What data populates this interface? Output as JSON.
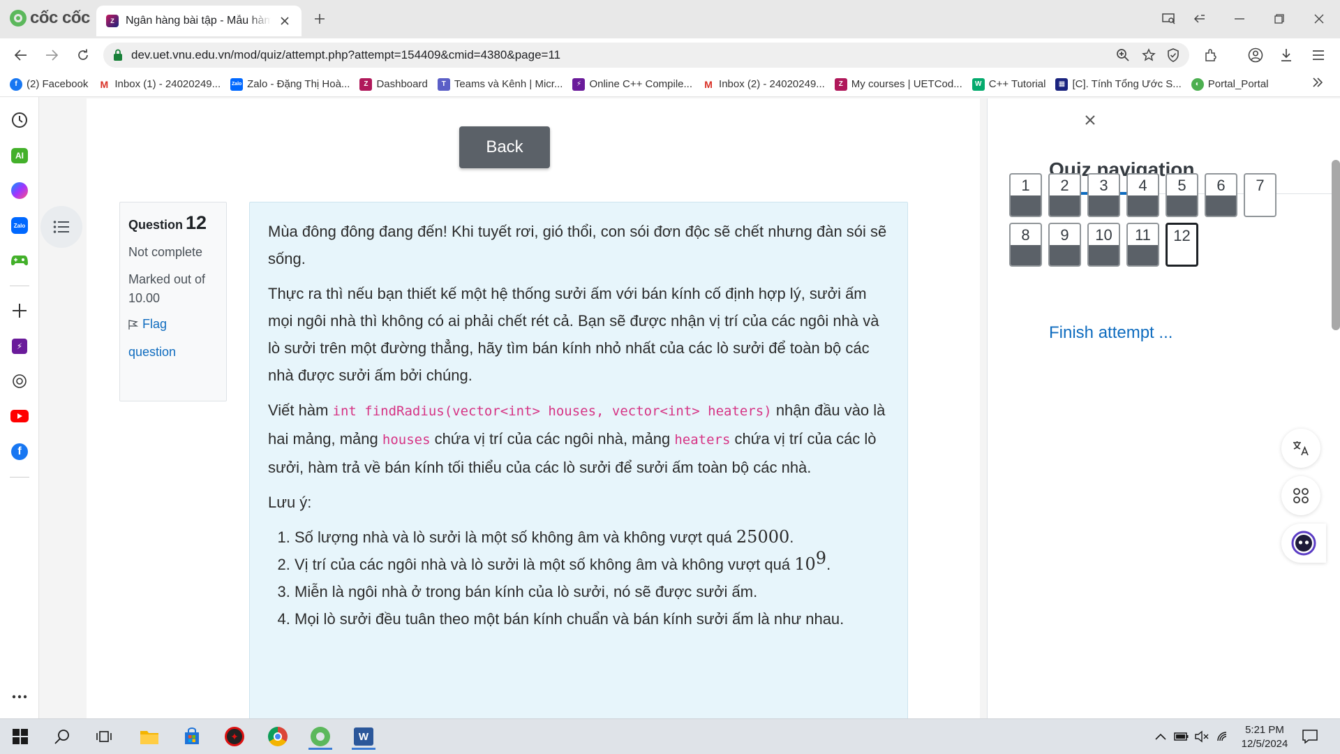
{
  "browser": {
    "brand": "cốc cốc",
    "tab_title": "Ngân hàng bài tập - Mẫu hàm",
    "url": "dev.uet.vnu.edu.vn/mod/quiz/attempt.php?attempt=154409&cmid=4380&page=11"
  },
  "bookmarks": [
    {
      "label": "(2) Facebook",
      "icon": "facebook-icon",
      "color": "#1877f2"
    },
    {
      "label": "Inbox (1) - 24020249...",
      "icon": "gmail-icon",
      "color": "#d93025"
    },
    {
      "label": "Zalo - Đặng Thị Hoà...",
      "icon": "zalo-icon",
      "color": "#0068ff"
    },
    {
      "label": "Dashboard",
      "icon": "moodle-icon",
      "color": "#b0185a"
    },
    {
      "label": "Teams và Kênh | Micr...",
      "icon": "teams-icon",
      "color": "#5b5fc7"
    },
    {
      "label": "Online C++ Compile...",
      "icon": "compiler-icon",
      "color": "#6a1b9a"
    },
    {
      "label": "Inbox (2) - 24020249...",
      "icon": "gmail-icon",
      "color": "#d93025"
    },
    {
      "label": "My courses | UETCod...",
      "icon": "moodle-icon",
      "color": "#b0185a"
    },
    {
      "label": "C++ Tutorial",
      "icon": "w3schools-icon",
      "color": "#04aa6d"
    },
    {
      "label": "[C]. Tính Tổng Ước S...",
      "icon": "codeforces-icon",
      "color": "#1a237e"
    },
    {
      "label": "Portal_Portal",
      "icon": "portal-icon",
      "color": "#4caf50"
    }
  ],
  "quiz": {
    "back_label": "Back",
    "info": {
      "question_label": "Question",
      "question_number": "12",
      "status": "Not complete",
      "marked_label": "Marked out of",
      "marked_value": "10.00",
      "flag_label": "Flag question"
    },
    "text": {
      "p1": "Mùa đông đông đang đến! Khi tuyết rơi, gió thổi, con sói đơn độc sẽ chết nhưng đàn sói sẽ sống.",
      "p2": "Thực ra thì nếu bạn thiết kế một hệ thống sưởi ấm với bán kính cố định hợp lý, sưởi ấm mọi ngôi nhà thì không có ai phải chết rét cả. Bạn sẽ được nhận vị trí của các ngôi nhà và lò sưởi trên một đường thẳng, hãy tìm bán kính nhỏ nhất của các lò sưởi để toàn bộ các nhà được sưởi ấm bởi chúng.",
      "p3_a": "Viết hàm ",
      "p3_code1": "int findRadius(vector<int> houses, vector<int> heaters)",
      "p3_b": " nhận đầu vào là hai mảng, mảng ",
      "p3_code2": "houses",
      "p3_c": " chứa vị trí của các ngôi nhà, mảng ",
      "p3_code3": "heaters",
      "p3_d": " chứa vị trí của các lò sưởi, hàm trả về bán kính tối thiểu của các lò sưởi để sưởi ấm toàn bộ các nhà.",
      "note": "Lưu ý:",
      "item1_text": "Số lượng nhà và lò sưởi là một số không âm và không vượt quá ",
      "item1_math": "25000",
      "item2_text": "Vị trí của các ngôi nhà và lò sưởi là một số không âm và không vượt quá ",
      "item2_math_base": "10",
      "item2_math_exp": "9",
      "item3": "Miễn là ngôi nhà ở trong bán kính của lò sưởi, nó sẽ được sưởi ấm.",
      "item4": "Mọi lò sưởi đều tuân theo một bán kính chuẩn và bán kính sưởi ấm là như nhau."
    }
  },
  "navigation": {
    "title": "Quiz navigation",
    "questions": [
      {
        "label": "1",
        "answered": true
      },
      {
        "label": "2",
        "answered": true
      },
      {
        "label": "3",
        "answered": true
      },
      {
        "label": "4",
        "answered": true
      },
      {
        "label": "5",
        "answered": true
      },
      {
        "label": "6",
        "answered": true
      },
      {
        "label": "7",
        "answered": false
      },
      {
        "label": "8",
        "answered": true
      },
      {
        "label": "9",
        "answered": true
      },
      {
        "label": "10",
        "answered": true
      },
      {
        "label": "11",
        "answered": true
      },
      {
        "label": "12",
        "answered": false,
        "current": true
      }
    ],
    "finish_label": "Finish attempt ..."
  },
  "taskbar": {
    "time": "5:21 PM",
    "date": "12/5/2024"
  },
  "colors": {
    "accent": "#0f6cbf",
    "question_bg": "#e7f5fb",
    "back_button": "#5b6168",
    "answered_fill": "#5b6168"
  }
}
